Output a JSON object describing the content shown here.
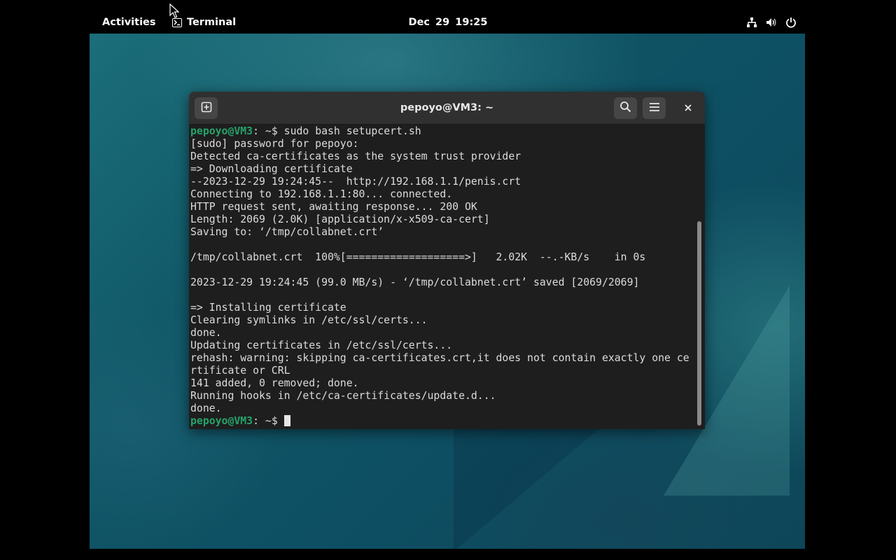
{
  "topbar": {
    "activities_label": "Activities",
    "app_name": "Terminal",
    "clock": "Dec 29  19:25",
    "status_icons": [
      "network-icon",
      "volume-icon",
      "power-icon"
    ]
  },
  "terminal": {
    "title": "pepoyo@VM3: ~",
    "buttons": [
      "new-tab-icon",
      "search-icon",
      "hamburger-menu-icon",
      "close-icon"
    ],
    "prompt_user": "pepoyo@VM3",
    "prompt_suffix": ": ~$",
    "command": "sudo bash setupcert.sh",
    "output_lines": [
      "[sudo] password for pepoyo:",
      "Detected ca-certificates as the system trust provider",
      "=> Downloading certificate",
      "--2023-12-29 19:24:45--  http://192.168.1.1/penis.crt",
      "Connecting to 192.168.1.1:80... connected.",
      "HTTP request sent, awaiting response... 200 OK",
      "Length: 2069 (2.0K) [application/x-x509-ca-cert]",
      "Saving to: ‘/tmp/collabnet.crt’",
      "",
      "/tmp/collabnet.crt  100%[===================>]   2.02K  --.-KB/s    in 0s",
      "",
      "2023-12-29 19:24:45 (99.0 MB/s) - ‘/tmp/collabnet.crt’ saved [2069/2069]",
      "",
      "=> Installing certificate",
      "Clearing symlinks in /etc/ssl/certs...",
      "done.",
      "Updating certificates in /etc/ssl/certs...",
      "rehash: warning: skipping ca-certificates.crt,it does not contain exactly one ce",
      "rtificate or CRL",
      "141 added, 0 removed; done.",
      "Running hooks in /etc/ca-certificates/update.d...",
      "done."
    ]
  },
  "colors": {
    "topbar_bg": "#000000",
    "terminal_bg": "#1e1e1e",
    "header_bg": "#303030",
    "prompt_green": "#26a269",
    "text": "#dcdcdc"
  }
}
